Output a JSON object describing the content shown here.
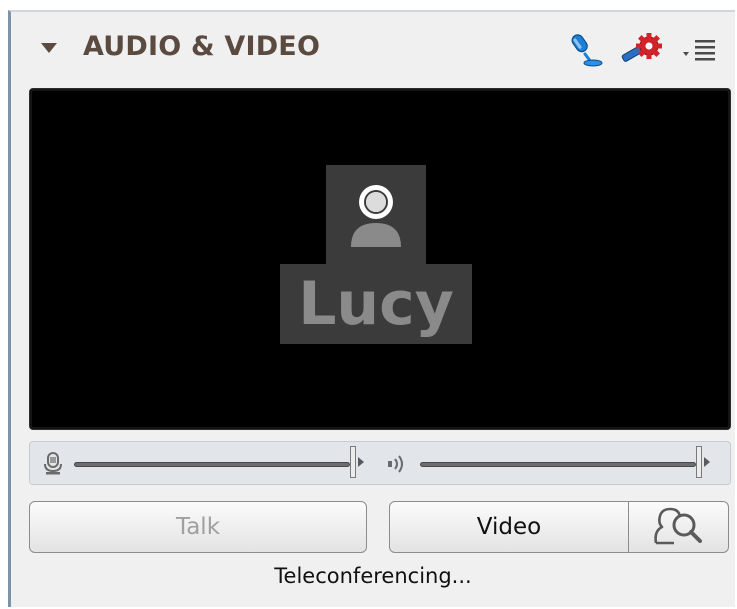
{
  "panel": {
    "title": "AUDIO & VIDEO",
    "header_icons": [
      "microphone-settings-icon",
      "gear-settings-icon",
      "options-menu-icon"
    ]
  },
  "video": {
    "participant_name": "Lucy",
    "avatar_icon": "person-icon"
  },
  "audio_controls": {
    "microphone_icon": "microphone-icon",
    "microphone_level": 1.0,
    "speaker_icon": "speaker-icon",
    "speaker_level": 1.0
  },
  "buttons": {
    "talk_label": "Talk",
    "video_label": "Video",
    "search_icon": "person-search-icon"
  },
  "status_text": "Teleconferencing...",
  "colors": {
    "title": "#5a4a3f",
    "accent_blue": "#1e7fd6",
    "accent_red": "#d3232a",
    "video_bg": "#000000",
    "disabled_text": "#a0a0a0"
  }
}
